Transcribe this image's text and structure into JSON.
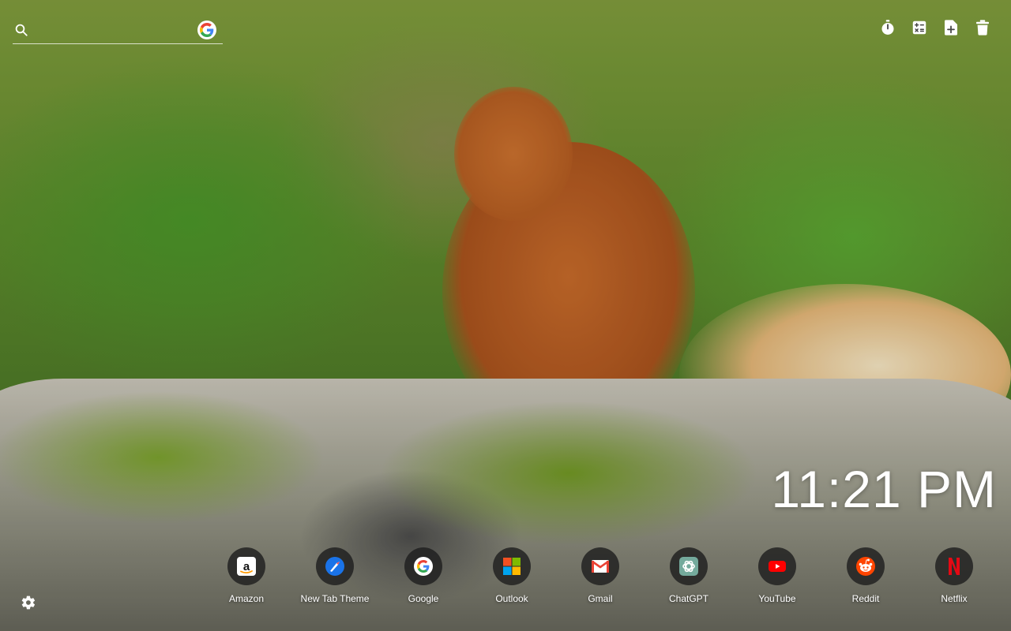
{
  "search": {
    "placeholder": "",
    "engine_icon": "google-g-icon"
  },
  "toolbar": {
    "items": [
      {
        "name": "timer-icon"
      },
      {
        "name": "calculator-icon"
      },
      {
        "name": "add-note-icon"
      },
      {
        "name": "trash-icon"
      }
    ]
  },
  "clock": {
    "time": "11:21 PM"
  },
  "shortcuts": [
    {
      "label": "Amazon",
      "icon": "amazon-icon"
    },
    {
      "label": "New Tab Theme",
      "icon": "new-tab-theme-icon"
    },
    {
      "label": "Google",
      "icon": "google-icon"
    },
    {
      "label": "Outlook",
      "icon": "outlook-icon"
    },
    {
      "label": "Gmail",
      "icon": "gmail-icon"
    },
    {
      "label": "ChatGPT",
      "icon": "chatgpt-icon"
    },
    {
      "label": "YouTube",
      "icon": "youtube-icon"
    },
    {
      "label": "Reddit",
      "icon": "reddit-icon"
    },
    {
      "label": "Netflix",
      "icon": "netflix-icon"
    }
  ],
  "settings": {
    "icon": "gear-icon"
  },
  "colors": {
    "google_blue": "#4285F4",
    "google_red": "#EA4335",
    "google_yellow": "#FBBC05",
    "google_green": "#34A853",
    "youtube_red": "#FF0000",
    "reddit_orange": "#FF4500",
    "netflix_red": "#E50914",
    "chatgpt_teal": "#74AA9C"
  }
}
